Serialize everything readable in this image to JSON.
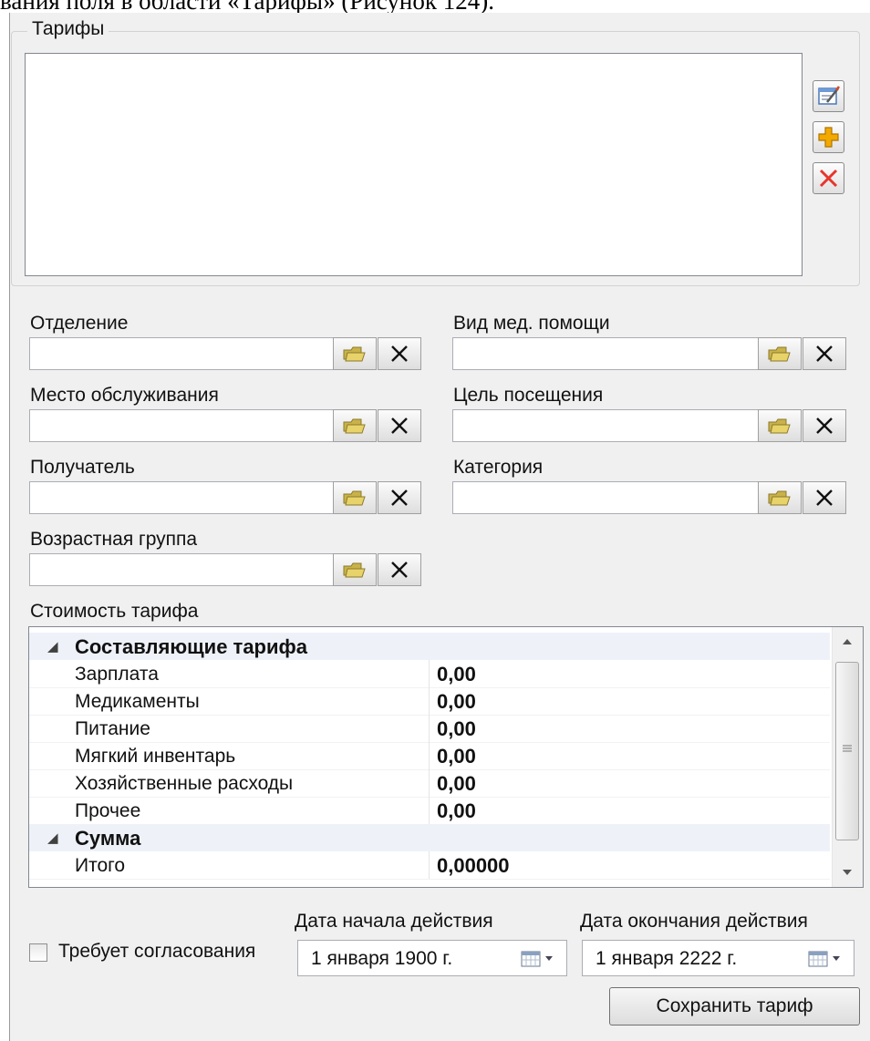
{
  "caption_top": "вания поля в области «Тарифы» (Рисунок 124).",
  "tariffs": {
    "title": "Тарифы",
    "buttons": {
      "edit": "edit-icon",
      "add": "add-icon",
      "delete": "delete-icon"
    }
  },
  "fields": {
    "department": {
      "label": "Отделение",
      "value": ""
    },
    "care_type": {
      "label": "Вид мед. помощи",
      "value": ""
    },
    "service_place": {
      "label": "Место обслуживания",
      "value": ""
    },
    "visit_purpose": {
      "label": "Цель посещения",
      "value": ""
    },
    "recipient": {
      "label": "Получатель",
      "value": ""
    },
    "category": {
      "label": "Категория",
      "value": ""
    },
    "age_group": {
      "label": "Возрастная группа",
      "value": ""
    }
  },
  "cost": {
    "label": "Стоимость тарифа",
    "components_title": "Составляющие тарифа",
    "rows": [
      {
        "name": "Зарплата",
        "value": "0,00"
      },
      {
        "name": "Медикаменты",
        "value": "0,00"
      },
      {
        "name": "Питание",
        "value": "0,00"
      },
      {
        "name": "Мягкий инвентарь",
        "value": "0,00"
      },
      {
        "name": "Хозяйственные расходы",
        "value": "0,00"
      },
      {
        "name": "Прочее",
        "value": "0,00"
      }
    ],
    "sum_title": "Сумма",
    "total": {
      "name": "Итого",
      "value": "0,00000"
    }
  },
  "approval": {
    "label": "Требует согласования",
    "checked": false
  },
  "date_start": {
    "label": "Дата начала действия",
    "value": "1  января  1900 г."
  },
  "date_end": {
    "label": "Дата окончания действия",
    "value": "1  января  2222 г."
  },
  "save_label": "Сохранить тариф",
  "colors": {
    "panel": "#f0f0f0",
    "add_icon": "#f2a900",
    "delete_icon": "#e8352c",
    "category_row": "#eef2f8"
  }
}
